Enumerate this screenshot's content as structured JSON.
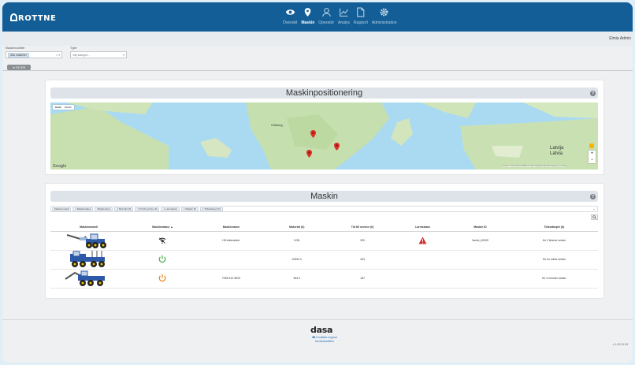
{
  "app": {
    "logo": "ROTTNE",
    "logo_sub": "",
    "user": "Elmia Admin"
  },
  "nav": [
    {
      "label": "Översikt",
      "icon": "eye-icon",
      "active": false
    },
    {
      "label": "Maskin",
      "icon": "map-pin-icon",
      "active": true
    },
    {
      "label": "Operatör",
      "icon": "person-icon",
      "active": false
    },
    {
      "label": "Analys",
      "icon": "chart-icon",
      "active": false
    },
    {
      "label": "Rapport",
      "icon": "document-icon",
      "active": false
    },
    {
      "label": "Administration",
      "icon": "gear-icon",
      "active": false
    }
  ],
  "filters": {
    "machine_label": "Maskinmodeller",
    "machine_chip": "Alla maskiner",
    "machine_clear": "× ▾",
    "type_label": "Typer",
    "type_placeholder": "Välj kategori...",
    "type_arrow": "▾",
    "filter_tab": "▼ FILTER"
  },
  "map_panel": {
    "title": "Maskinpositionering",
    "map_type": [
      "Karta",
      "Satellit"
    ],
    "places": [
      "Göteborg",
      "Latvija",
      "Latvia"
    ],
    "google": "Google",
    "attribution": "Kartdata ©2021 GeoBasis-DE/BKG (©2009), Google  Användarvillkor  Rapportera ett kartfel"
  },
  "machine_panel": {
    "title": "Maskin",
    "columns_chips": [
      "Maskinmodell",
      "× Maskinstatus",
      "Maskinnamn",
      "× Motortid (h)",
      "× Tid till service (h)",
      "× Larmstatus",
      "× Maskin ID",
      "× Tidsstämpel (h)"
    ],
    "clear_all": "×",
    "headers": [
      "Maskinmodell",
      "Maskinstatus ▲",
      "Maskinnamn",
      "Motortid (h)",
      "Tid till service (h)",
      "Larmstatus",
      "Maskin ID",
      "Tidsstämpel (h)"
    ],
    "rows": [
      {
        "status": "wifi-icon",
        "name": "H8 testmaskin",
        "motor": "1251",
        "service": "320",
        "alarm": true,
        "id": "Vamix_62000",
        "time": "för 2 timmar sedan"
      },
      {
        "status": "power-green-icon",
        "name": "",
        "motor": "10993 h",
        "service": "423",
        "alarm": false,
        "id": "",
        "time": "för en minut sedan"
      },
      {
        "status": "power-orange-icon",
        "name": "7055 610 5529",
        "motor": "353 h",
        "service": "187",
        "alarm": false,
        "id": "",
        "time": "för 4 minuter sedan"
      }
    ]
  },
  "footer": {
    "brand": "dasa",
    "support": "Kontakta support",
    "terms": "Användarvillkor",
    "version": "v 1.00.01.93"
  },
  "colors": {
    "topbar": "#135e96",
    "alarm": "#d32f2f",
    "power_green": "#4caf50",
    "power_orange": "#e8891f"
  }
}
